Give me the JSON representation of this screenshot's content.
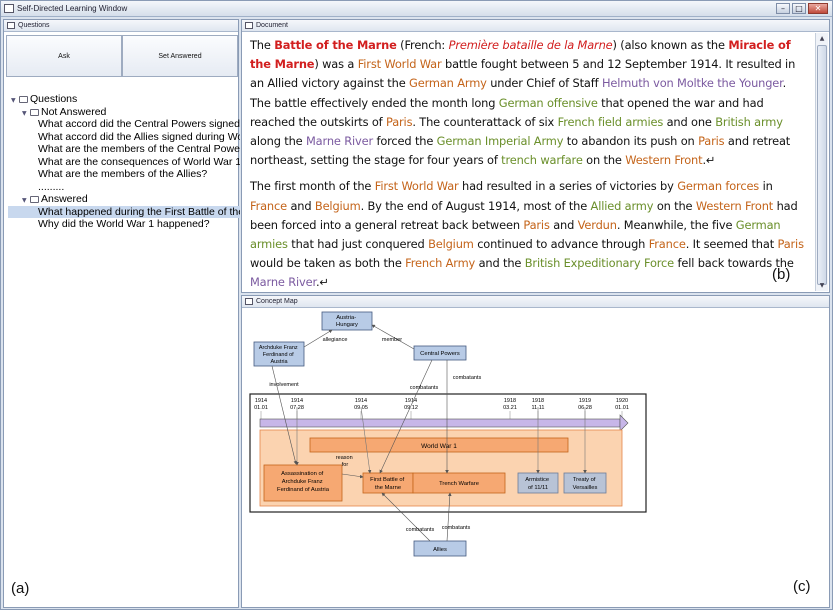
{
  "window": {
    "title": "Self-Directed Learning Window",
    "buttons": [
      "–",
      "□",
      "✕"
    ]
  },
  "questions_panel": {
    "title": "Questions",
    "ask_label": "Ask",
    "set_answered_label": "Set Answered",
    "root": "Questions",
    "not_answered_label": "Not Answered",
    "not_answered": [
      "What accord did the Central Powers signed dur",
      "What accord did the Allies signed during World",
      "What are the members of the Central Powers?",
      "What are the consequences of World War 1?",
      "What are the members of the Allies?",
      "........."
    ],
    "answered_label": "Answered",
    "answered": [
      "What happened during the First Battle of the Ma",
      "Why did the World War 1 happened?"
    ],
    "panel_label": "(a)"
  },
  "document_panel": {
    "title": "Document",
    "panel_label": "(b)",
    "colors": {
      "red": "#d21f1f",
      "orange": "#c4641a",
      "green": "#6a8f2a",
      "purple": "#7b5aa0"
    },
    "p1": [
      "The ",
      "Battle of the Marne",
      " (French: ",
      "Première bataille de la Marne",
      ") (also known as the ",
      "Miracle of the Marne",
      ") was a ",
      "First World War",
      " battle fought between 5 and 12 September 1914. It resulted in an Allied victory against the ",
      "German Army",
      " under Chief of Staff ",
      "Helmuth von Moltke the Younger",
      ". The battle effectively ended the month long ",
      "German offensive",
      " that opened the war and had reached the outskirts of ",
      "Paris",
      ". The counterattack of six ",
      "French field armies",
      " and one ",
      "British army",
      " along the ",
      "Marne River",
      " forced the ",
      "German Imperial Army",
      " to abandon its push on ",
      "Paris",
      " and retreat northeast, setting the stage for four years of ",
      "trench warfare",
      " on the ",
      "Western Front",
      ".↵"
    ],
    "p2": [
      "The first month of the ",
      "First World War",
      " had resulted in a series of victories by ",
      "German forces",
      " in ",
      "France",
      " and ",
      "Belgium",
      ". By the end of August 1914,  most of the ",
      "Allied army",
      " on the ",
      "Western Front",
      " had been forced into a general retreat back between ",
      "Paris",
      " and ",
      "Verdun",
      ". Meanwhile, the five ",
      "German armies",
      " that had just conquered ",
      "Belgium",
      " continued to advance through ",
      "France",
      ". It seemed that ",
      "Paris",
      " would be taken as both the ",
      "French Army",
      " and the ",
      "British Expeditionary Force",
      " fell back towards the ",
      "Marne River",
      ".↵"
    ]
  },
  "concept_map": {
    "title": "Concept Map",
    "panel_label": "(c)",
    "nodes": {
      "austria": "Austria-Hungary",
      "archduke": "Archduke Franz Ferdinand of Austria",
      "central": "Central Powers",
      "allies": "Allies",
      "ww1": "World War 1",
      "assassination": "Assassination of Archduke Franz Ferdinand of Austria",
      "firstbattle": "First Battle of the Marne",
      "trench": "Trench Warfare",
      "armistice": "Armistice of 11/11",
      "treaty": "Treaty of Versailles"
    },
    "edges": {
      "allegiance": "allegiance",
      "member": "member",
      "involvement": "involvement",
      "combatants": "combatants",
      "reason_for": "reason for"
    },
    "timeline": [
      [
        "1914",
        "01.01"
      ],
      [
        "1914",
        "07.28"
      ],
      [
        "1914",
        "09.05"
      ],
      [
        "1914",
        "09.12"
      ],
      [
        "1918",
        "03.21"
      ],
      [
        "1918",
        "11.11"
      ],
      [
        "1919",
        "06.28"
      ],
      [
        "1920",
        "01.01"
      ]
    ]
  }
}
